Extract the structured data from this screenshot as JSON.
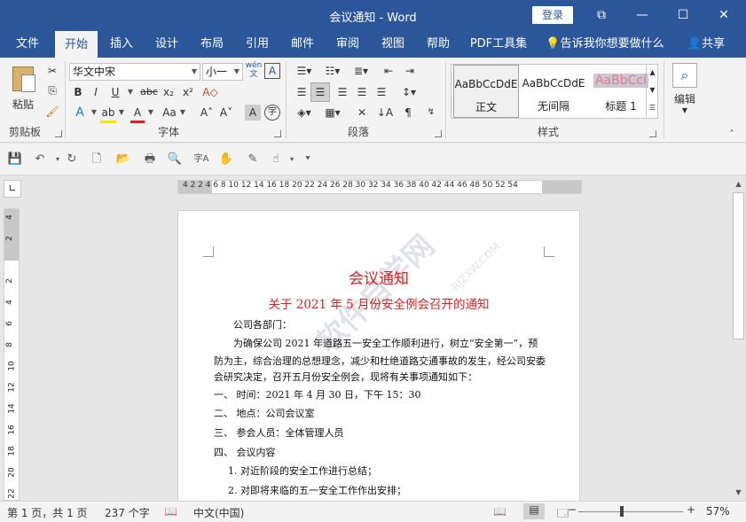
{
  "window": {
    "title": "会议通知 - Word",
    "login_label": "登录",
    "controls": [
      "⧉",
      "—",
      "☐",
      "✕"
    ]
  },
  "tabs": [
    {
      "label": "文件"
    },
    {
      "label": "开始",
      "active": true
    },
    {
      "label": "插入"
    },
    {
      "label": "设计"
    },
    {
      "label": "布局"
    },
    {
      "label": "引用"
    },
    {
      "label": "邮件"
    },
    {
      "label": "审阅"
    },
    {
      "label": "视图"
    },
    {
      "label": "帮助"
    },
    {
      "label": "PDF工具集"
    },
    {
      "label": "告诉我你想要做什么"
    },
    {
      "label": "共享"
    }
  ],
  "ribbon": {
    "clipboard": {
      "paste_label": "粘贴",
      "group_label": "剪贴板"
    },
    "font": {
      "font_name": "华文中宋",
      "font_size": "小一",
      "group_label": "字体",
      "phonetic_label": "wén"
    },
    "paragraph": {
      "group_label": "段落"
    },
    "styles": {
      "group_label": "样式",
      "items": [
        {
          "preview": "AaBbCcDdE",
          "name": "正文"
        },
        {
          "preview": "AaBbCcDdE",
          "name": "无间隔"
        },
        {
          "preview": "AaBbCcl",
          "name": "标题 1"
        }
      ]
    },
    "editing": {
      "label": "编辑"
    }
  },
  "ruler": {
    "ticks": "4  2     2  4  6  8 10 12 14 16 18 20 22 24 26 28 30 32 34 36 38 40 42 44 46 48 50 52 54",
    "vticks": [
      "4",
      "2",
      "2",
      "4",
      "6",
      "8",
      "10",
      "12",
      "14",
      "16",
      "18",
      "20",
      "22"
    ]
  },
  "document": {
    "title": "会议通知",
    "subtitle": "关于 2021 年 5 月份安全例会召开的通知",
    "lines": [
      "公司各部门：",
      "为确保公司 2021 年道路五一安全工作顺利进行，树立“安全第一”，预",
      "防为主，综合治理的总想理念，减少和杜绝道路交通事故的发生，经公司安委",
      "会研究决定，召开五月份安全例会，现将有关事项通知如下：",
      "一、    时间：2021 年 4 月 30 日，下午 15：30",
      "二、    地点：公司会议室",
      "三、    参会人员：全体管理人员",
      "四、    会议内容",
      "1.  对近阶段的安全工作进行总结；",
      "2.  对即将来临的五一安全工作作出安排；"
    ],
    "watermark": "软件自学网",
    "watermark_url": "RJZXW.COM"
  },
  "status": {
    "page": "第 1 页，共 1 页",
    "words": "237 个字",
    "language": "中文(中国)",
    "zoom": "57%",
    "zoom_minus": "−",
    "zoom_plus": "+"
  }
}
